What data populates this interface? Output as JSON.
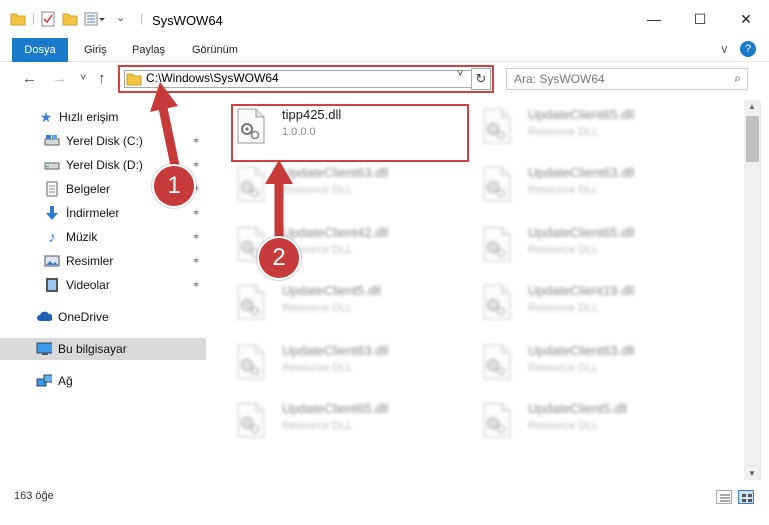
{
  "window": {
    "title": "SysWOW64",
    "minimize": "—",
    "maximize": "☐",
    "close": "✕"
  },
  "ribbon": {
    "tabs": [
      "Dosya",
      "Giriş",
      "Paylaş",
      "Görünüm"
    ],
    "expand": "∨",
    "help": "?"
  },
  "nav": {
    "back": "←",
    "forward": "→",
    "recent": "˅",
    "up": "↑",
    "address_path": "C:\\Windows\\SysWOW64",
    "dropdown": "˅",
    "refresh": "↻",
    "search_placeholder": "Ara: SysWOW64",
    "search_icon": "⌕"
  },
  "sidebar": {
    "items": [
      {
        "label": "Hızlı erişim",
        "icon": "star-icon",
        "pinned": false
      },
      {
        "label": "Yerel Disk (C:)",
        "icon": "drive-icon",
        "pinned": true
      },
      {
        "label": "Yerel Disk (D:)",
        "icon": "drive-icon",
        "pinned": true
      },
      {
        "label": "Belgeler",
        "icon": "document-icon",
        "pinned": true
      },
      {
        "label": "İndirmeler",
        "icon": "download-icon",
        "pinned": true
      },
      {
        "label": "Müzik",
        "icon": "music-icon",
        "pinned": true
      },
      {
        "label": "Resimler",
        "icon": "pictures-icon",
        "pinned": true
      },
      {
        "label": "Videolar",
        "icon": "video-icon",
        "pinned": true
      },
      {
        "label": "OneDrive",
        "icon": "cloud-icon",
        "pinned": false
      },
      {
        "label": "Bu bilgisayar",
        "icon": "computer-icon",
        "pinned": false,
        "selected": true
      },
      {
        "label": "Ağ",
        "icon": "network-icon",
        "pinned": false
      }
    ],
    "pin_glyph": "✶"
  },
  "files": [
    {
      "name": "tipp425.dll",
      "desc": "1.0.0.0",
      "highlighted": true
    },
    {
      "name": "UpdateClient65.dll",
      "desc": "Resource DLL"
    },
    {
      "name": "UpdateClient63.dll",
      "desc": "Resource DLL"
    },
    {
      "name": "UpdateClient63.dll",
      "desc": "Resource DLL"
    },
    {
      "name": "UpdateClient42.dll",
      "desc": "Resource DLL"
    },
    {
      "name": "UpdateClient65.dll",
      "desc": "Resource DLL"
    },
    {
      "name": "UpdateClient5.dll",
      "desc": "Resource DLL"
    },
    {
      "name": "UpdateClient19.dll",
      "desc": "Resource DLL"
    },
    {
      "name": "UpdateClient63.dll",
      "desc": "Resource DLL"
    },
    {
      "name": "UpdateClient63.dll",
      "desc": "Resource DLL"
    },
    {
      "name": "UpdateClient65.dll",
      "desc": "Resource DLL"
    },
    {
      "name": "UpdateClient5.dll",
      "desc": "Resource DLL"
    }
  ],
  "status": {
    "count": "163 öğe"
  },
  "annotations": {
    "badge1": "1",
    "badge2": "2",
    "color": "#c73a3a"
  },
  "colors": {
    "accent": "#1979ca",
    "highlight": "#d24040",
    "selected": "#d9d9d9"
  }
}
